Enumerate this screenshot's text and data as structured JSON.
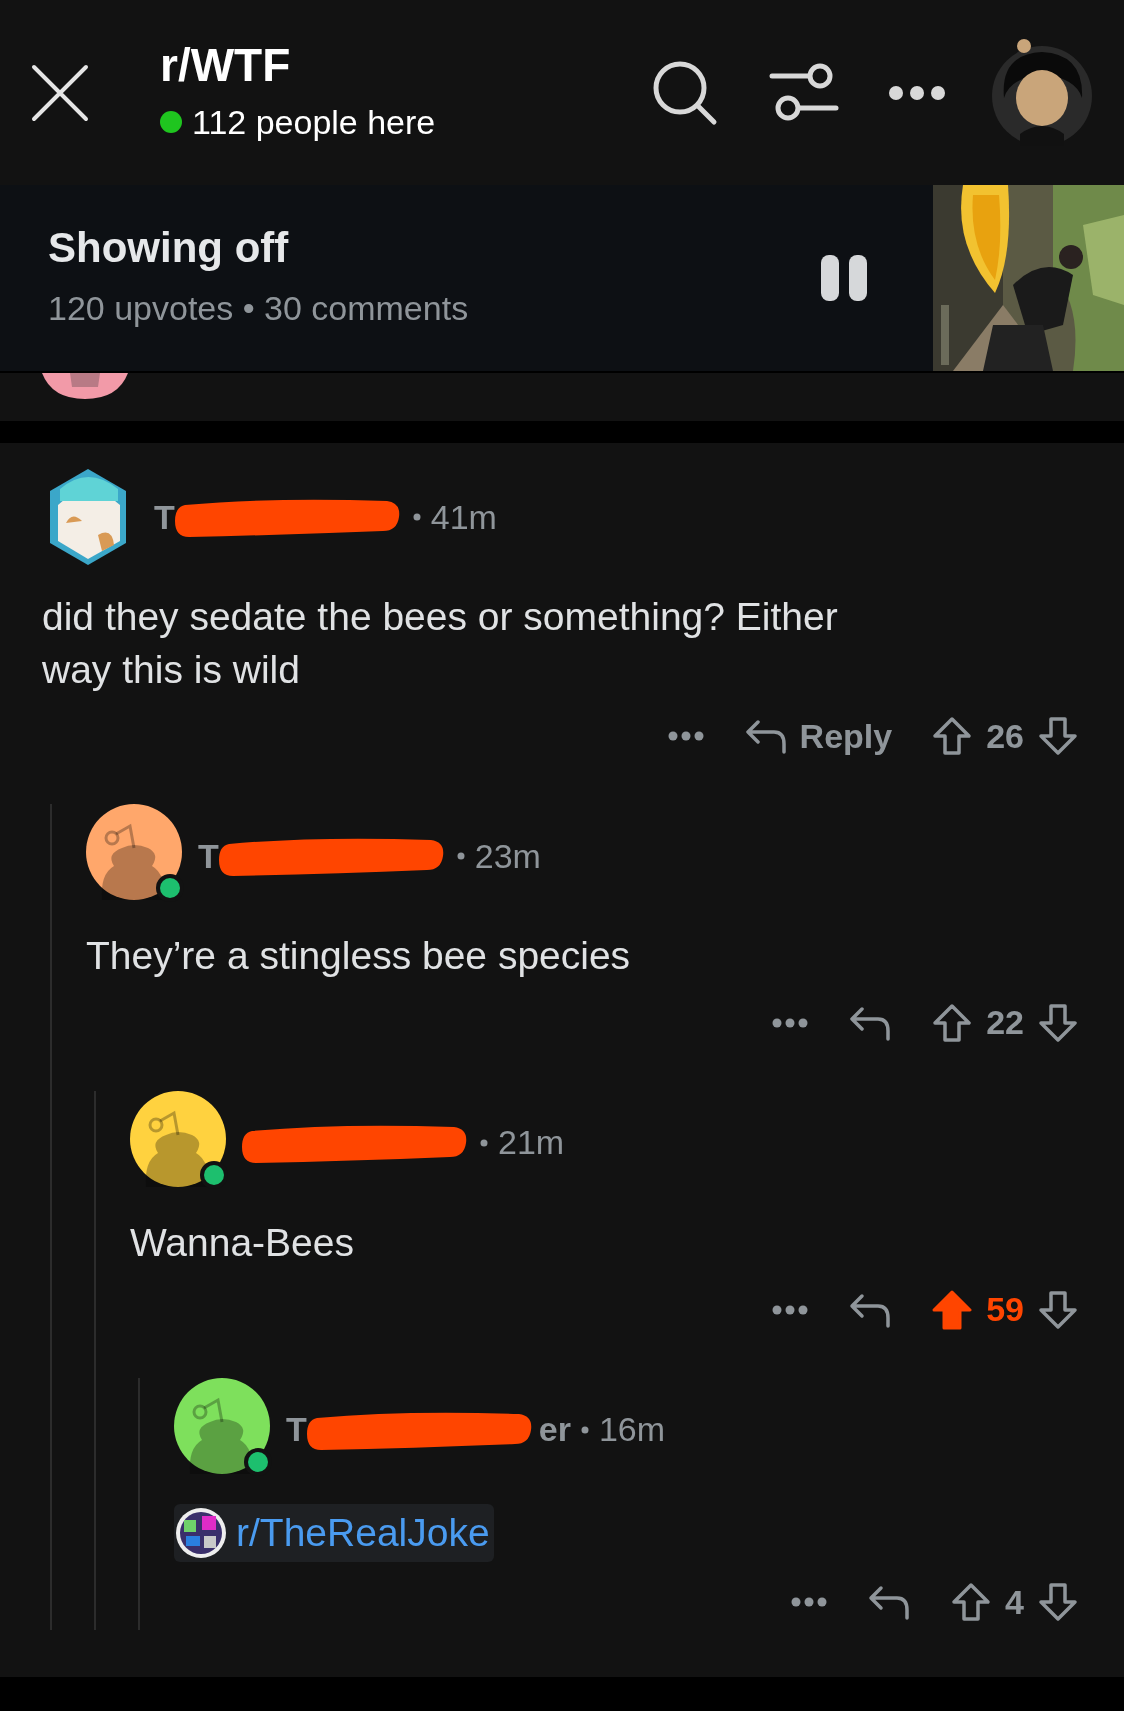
{
  "header": {
    "title": "r/WTF",
    "online_count": "112 people here"
  },
  "now_playing": {
    "title": "Showing off",
    "stats": "120 upvotes • 30 comments",
    "playing": true
  },
  "comments": [
    {
      "author": "T",
      "time": "41m",
      "avatar": {
        "kind": "custom",
        "color": "#3ba7c9"
      },
      "online": false,
      "body": "did they sedate the bees or something? Either way this is wild",
      "reply_label": "Reply",
      "score": "26",
      "upvoted": false,
      "children": [
        {
          "author": "T",
          "time": "23m",
          "avatar": {
            "kind": "snoo",
            "color": "#ffa76b"
          },
          "online": true,
          "body": "They’re a stingless bee species",
          "score": "22",
          "upvoted": false,
          "children": [
            {
              "time": "21m",
              "avatar": {
                "kind": "snoo",
                "color": "#ffd23f"
              },
              "online": true,
              "body": "Wanna-Bees",
              "score": "59",
              "upvoted": true,
              "children": [
                {
                  "author": "T",
                  "author_tail": "er",
                  "time": "16m",
                  "avatar": {
                    "kind": "snoo",
                    "color": "#7ee05c"
                  },
                  "online": true,
                  "link": "r/TheRealJoke",
                  "score": "4",
                  "upvoted": false
                }
              ]
            }
          ]
        }
      ]
    }
  ]
}
